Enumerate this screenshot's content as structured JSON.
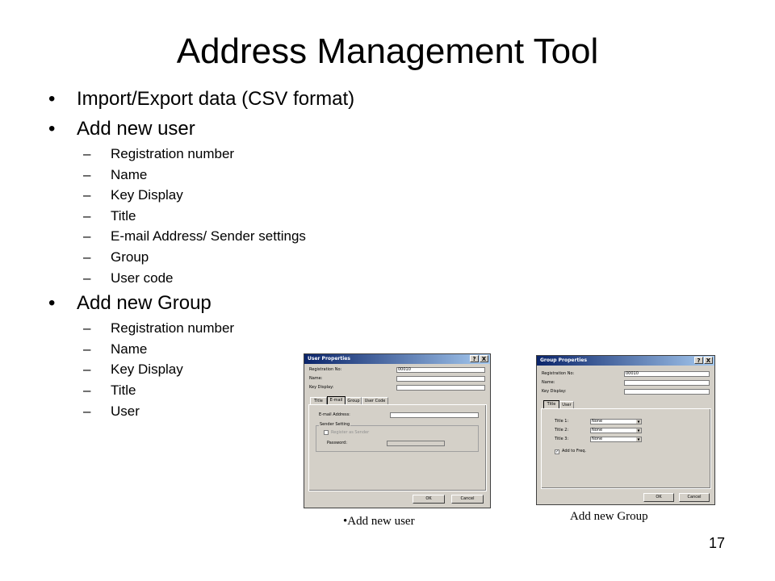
{
  "slide": {
    "title": "Address Management Tool",
    "page_number": "17"
  },
  "bullets": [
    {
      "text": "Import/Export data (CSV format)",
      "sub": []
    },
    {
      "text": "Add new user",
      "sub": [
        "Registration number",
        "Name",
        "Key Display",
        "Title",
        "E-mail Address/ Sender settings",
        "Group",
        "User code"
      ]
    },
    {
      "text": "Add new Group",
      "sub": [
        "Registration number",
        "Name",
        "Key Display",
        "Title",
        "User"
      ]
    }
  ],
  "bullet_symbol": "•",
  "dash_symbol": "–",
  "user_dialog": {
    "title": "User Properties",
    "help_btn": "?",
    "close_btn": "X",
    "reg_label": "Registration No:",
    "reg_value": "00010",
    "name_label": "Name:",
    "key_label": "Key Display:",
    "tabs": [
      "Title",
      "E-mail",
      "Group",
      "User Code"
    ],
    "email_label": "E-mail Address:",
    "sender_group": "Sender Setting",
    "register_sender": "Register as Sender",
    "password_label": "Password:",
    "ok": "OK",
    "cancel": "Cancel"
  },
  "group_dialog": {
    "title": "Group Properties",
    "help_btn": "?",
    "close_btn": "X",
    "reg_label": "Registration No:",
    "reg_value": "00010",
    "name_label": "Name:",
    "key_label": "Key Display:",
    "tabs": [
      "Title",
      "User"
    ],
    "title1_label": "Title 1:",
    "title2_label": "Title 2:",
    "title3_label": "Title 3:",
    "title_values": [
      "None",
      "None",
      "None"
    ],
    "add_freq": "Add to Freq.",
    "ok": "OK",
    "cancel": "Cancel"
  },
  "captions": {
    "user": "•Add new user",
    "group": "Add new Group"
  }
}
